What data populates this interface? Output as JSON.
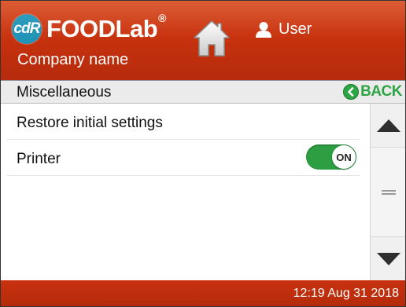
{
  "header": {
    "logo_badge": "cdR",
    "logo_text": "FOODLab",
    "logo_reg": "®",
    "company_name": "Company name",
    "user_label": "User"
  },
  "subbar": {
    "title": "Miscellaneous",
    "back_label": "BACK"
  },
  "menu": {
    "items": [
      {
        "label": "Restore initial settings"
      },
      {
        "label": "Printer",
        "toggle": "ON"
      }
    ]
  },
  "footer": {
    "clock": "12:19  Aug 31 2018"
  },
  "colors": {
    "header_red": "#c8320e",
    "accent_green": "#2ea544",
    "logo_blue": "#1f94b8"
  },
  "icons": {
    "home": "home-icon",
    "user": "user-icon",
    "back": "back-arrow-icon",
    "scroll_up": "chevron-up-icon",
    "scroll_down": "chevron-down-icon"
  }
}
